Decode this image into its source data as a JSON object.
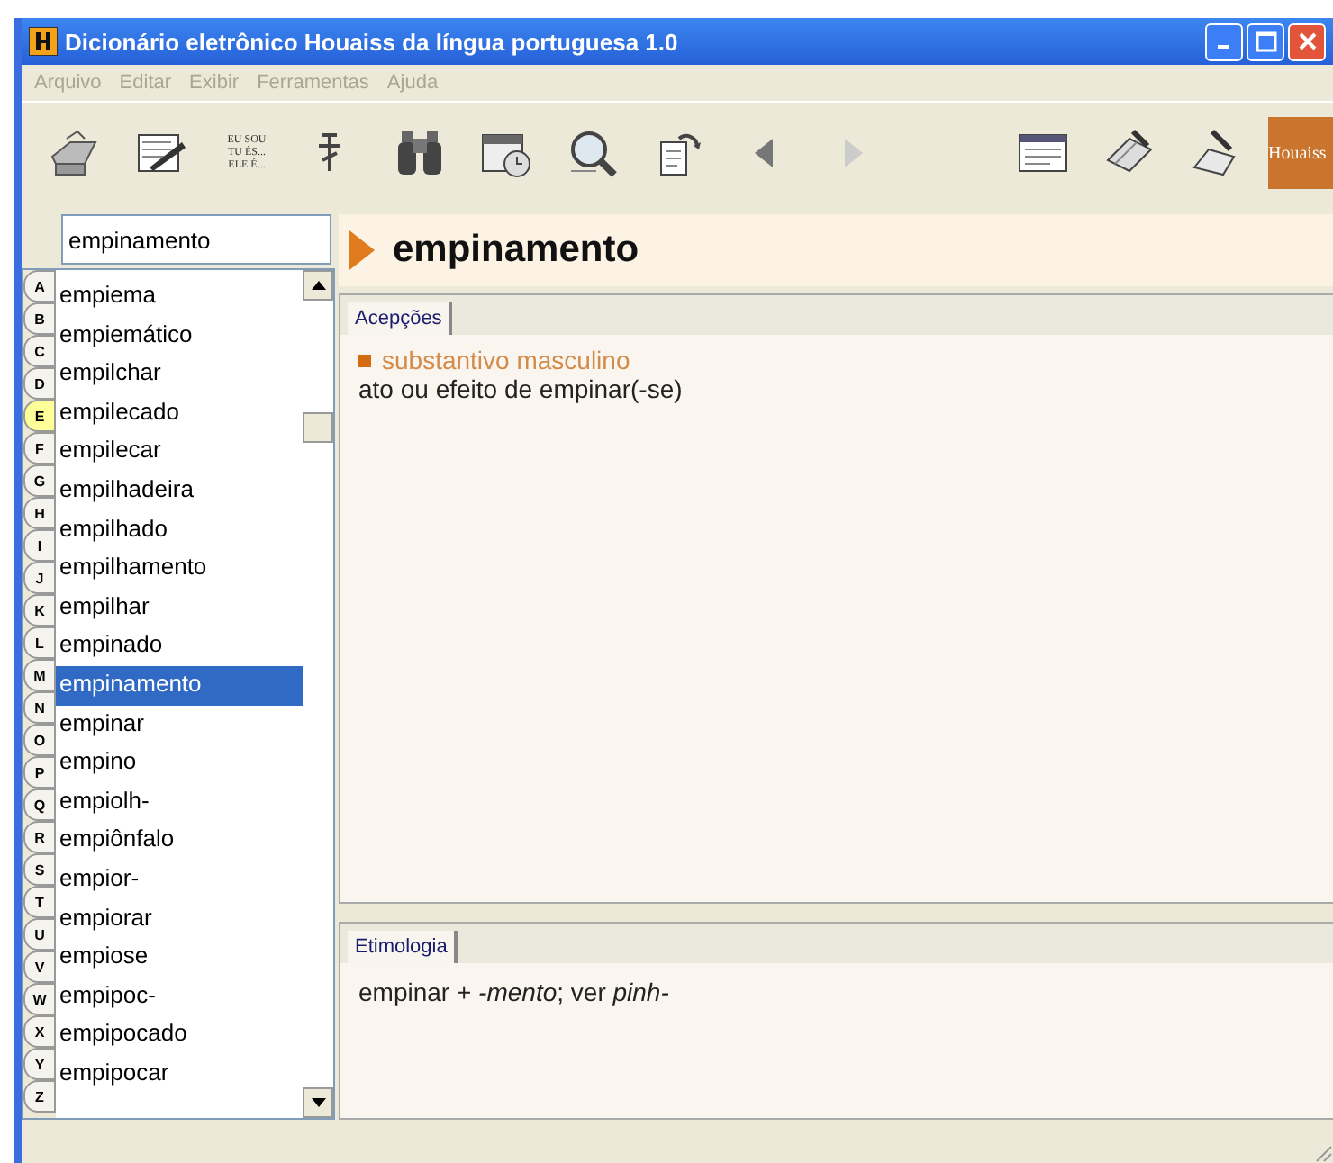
{
  "window": {
    "title": "Dicionário eletrônico Houaiss da língua portuguesa 1.0"
  },
  "menu": [
    {
      "label": "Arquivo",
      "disabled": true
    },
    {
      "label": "Editar",
      "disabled": true
    },
    {
      "label": "Exibir",
      "disabled": true
    },
    {
      "label": "Ferramentas",
      "disabled": true
    },
    {
      "label": "Ajuda",
      "disabled": true
    }
  ],
  "toolbar": {
    "conjugation_label": [
      "EU SOU",
      "TU ÉS...",
      "ELE É..."
    ],
    "logo": "Houaiss"
  },
  "search": {
    "value": "empinamento"
  },
  "letters": [
    {
      "label": "A",
      "selected": false
    },
    {
      "label": "B",
      "selected": false
    },
    {
      "label": "C",
      "selected": false
    },
    {
      "label": "D",
      "selected": false
    },
    {
      "label": "E",
      "selected": true
    },
    {
      "label": "F",
      "selected": false
    },
    {
      "label": "G",
      "selected": false
    },
    {
      "label": "H",
      "selected": false
    },
    {
      "label": "I",
      "selected": false
    },
    {
      "label": "J",
      "selected": false
    },
    {
      "label": "K",
      "selected": false
    },
    {
      "label": "L",
      "selected": false
    },
    {
      "label": "M",
      "selected": false
    },
    {
      "label": "N",
      "selected": false
    },
    {
      "label": "O",
      "selected": false
    },
    {
      "label": "P",
      "selected": false
    },
    {
      "label": "Q",
      "selected": false
    },
    {
      "label": "R",
      "selected": false
    },
    {
      "label": "S",
      "selected": false
    },
    {
      "label": "T",
      "selected": false
    },
    {
      "label": "U",
      "selected": false
    },
    {
      "label": "V",
      "selected": false
    },
    {
      "label": "W",
      "selected": false
    },
    {
      "label": "X",
      "selected": false
    },
    {
      "label": "Y",
      "selected": false
    },
    {
      "label": "Z",
      "selected": false
    }
  ],
  "words": [
    {
      "label": "empiema",
      "selected": false
    },
    {
      "label": "empiemático",
      "selected": false
    },
    {
      "label": "empilchar",
      "selected": false
    },
    {
      "label": "empilecado",
      "selected": false
    },
    {
      "label": "empilecar",
      "selected": false
    },
    {
      "label": "empilhadeira",
      "selected": false
    },
    {
      "label": "empilhado",
      "selected": false
    },
    {
      "label": "empilhamento",
      "selected": false
    },
    {
      "label": "empilhar",
      "selected": false
    },
    {
      "label": "empinado",
      "selected": false
    },
    {
      "label": "empinamento",
      "selected": true
    },
    {
      "label": "empinar",
      "selected": false
    },
    {
      "label": "empino",
      "selected": false
    },
    {
      "label": "empiolh-",
      "selected": false
    },
    {
      "label": "empiônfalo",
      "selected": false
    },
    {
      "label": "empior-",
      "selected": false
    },
    {
      "label": "empiorar",
      "selected": false
    },
    {
      "label": "empiose",
      "selected": false
    },
    {
      "label": "empipoc-",
      "selected": false
    },
    {
      "label": "empipocado",
      "selected": false
    },
    {
      "label": "empipocar",
      "selected": false
    }
  ],
  "entry": {
    "headword": "empinamento",
    "senses_tab": "Acepções",
    "senses": [
      {
        "class": "substantivo masculino",
        "definition": "ato ou efeito de empinar(-se)"
      }
    ],
    "etymology_tab": "Etimologia",
    "etymology": "empinar + *-mento*; ver *pinh-*"
  }
}
